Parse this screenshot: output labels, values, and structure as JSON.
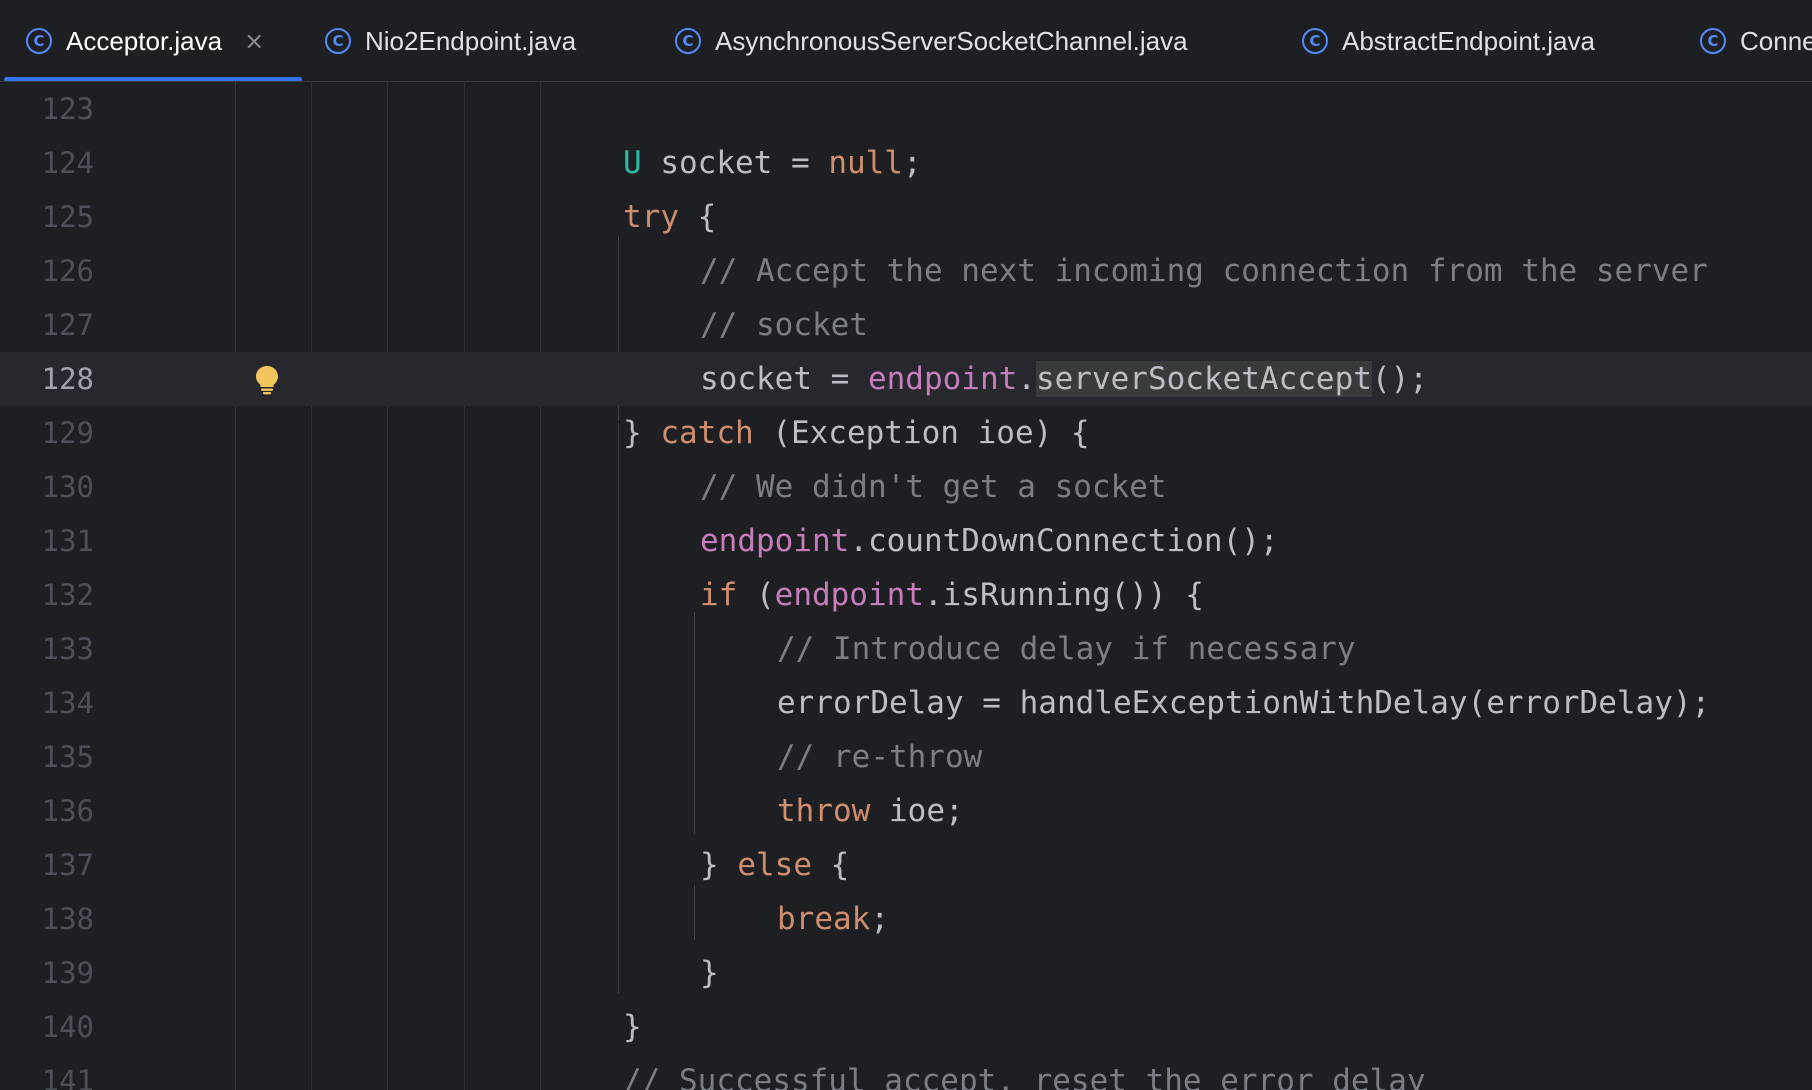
{
  "tabs": [
    {
      "label": "Acceptor.java",
      "icon": "class-icon",
      "active": true,
      "close": "×"
    },
    {
      "label": "Nio2Endpoint.java",
      "icon": "class-icon"
    },
    {
      "label": "AsynchronousServerSocketChannel.java",
      "icon": "class-icon"
    },
    {
      "label": "AbstractEndpoint.java",
      "icon": "class-icon"
    },
    {
      "label": "Conne",
      "icon": "class-icon"
    }
  ],
  "editor": {
    "current_line": 128,
    "lines": [
      {
        "num": "123",
        "tokens": []
      },
      {
        "num": "124",
        "tokens": [
          {
            "t": "U",
            "c": "type"
          },
          {
            "t": " socket = ",
            "c": "plain"
          },
          {
            "t": "null",
            "c": "kw"
          },
          {
            "t": ";",
            "c": "plain"
          }
        ]
      },
      {
        "num": "125",
        "tokens": [
          {
            "t": "try",
            "c": "kw"
          },
          {
            "t": " {",
            "c": "plain"
          }
        ]
      },
      {
        "num": "126",
        "tokens": [
          {
            "t": "// Accept the next incoming connection from the server",
            "c": "comment"
          }
        ]
      },
      {
        "num": "127",
        "tokens": [
          {
            "t": "// socket",
            "c": "comment"
          }
        ]
      },
      {
        "num": "128",
        "tokens": [
          {
            "t": "socket = ",
            "c": "plain"
          },
          {
            "t": "endpoint",
            "c": "field"
          },
          {
            "t": ".",
            "c": "plain"
          },
          {
            "t": "serverSocketAccept",
            "c": "hl"
          },
          {
            "t": "();",
            "c": "plain"
          }
        ]
      },
      {
        "num": "129",
        "tokens": [
          {
            "t": "} ",
            "c": "plain"
          },
          {
            "t": "catch",
            "c": "kw"
          },
          {
            "t": " (Exception ioe) {",
            "c": "plain"
          }
        ]
      },
      {
        "num": "130",
        "tokens": [
          {
            "t": "// We didn't get a socket",
            "c": "comment"
          }
        ]
      },
      {
        "num": "131",
        "tokens": [
          {
            "t": "endpoint",
            "c": "field"
          },
          {
            "t": ".countDownConnection();",
            "c": "plain"
          }
        ]
      },
      {
        "num": "132",
        "tokens": [
          {
            "t": "if",
            "c": "kw"
          },
          {
            "t": " (",
            "c": "plain"
          },
          {
            "t": "endpoint",
            "c": "field"
          },
          {
            "t": ".isRunning()) {",
            "c": "plain"
          }
        ]
      },
      {
        "num": "133",
        "tokens": [
          {
            "t": "// Introduce delay if necessary",
            "c": "comment"
          }
        ]
      },
      {
        "num": "134",
        "tokens": [
          {
            "t": "errorDelay = handleExceptionWithDelay(errorDelay);",
            "c": "plain"
          }
        ]
      },
      {
        "num": "135",
        "tokens": [
          {
            "t": "// re-throw",
            "c": "comment"
          }
        ]
      },
      {
        "num": "136",
        "tokens": [
          {
            "t": "throw",
            "c": "kw"
          },
          {
            "t": " ioe;",
            "c": "plain"
          }
        ]
      },
      {
        "num": "137",
        "tokens": [
          {
            "t": "} ",
            "c": "plain"
          },
          {
            "t": "else",
            "c": "kw"
          },
          {
            "t": " {",
            "c": "plain"
          }
        ]
      },
      {
        "num": "138",
        "tokens": [
          {
            "t": "break",
            "c": "kw"
          },
          {
            "t": ";",
            "c": "plain"
          }
        ]
      },
      {
        "num": "139",
        "tokens": [
          {
            "t": "}",
            "c": "plain"
          }
        ]
      },
      {
        "num": "140",
        "tokens": [
          {
            "t": "}",
            "c": "plain"
          }
        ]
      },
      {
        "num": "141",
        "tokens": [
          {
            "t": "// Successful accept, reset the error delay",
            "c": "comment"
          }
        ]
      }
    ],
    "gutter_icon": {
      "line": "128",
      "icon": "lightbulb-icon"
    }
  },
  "colors": {
    "background": "#1e1f22",
    "current_line": "#26282e",
    "keyword": "#cf8e6d",
    "field": "#c77dbb",
    "comment": "#7a7e85",
    "type": "#2fbaa3",
    "plain": "#bcbec4",
    "tab_accent": "#3574f0",
    "bulb": "#f2c55c"
  }
}
